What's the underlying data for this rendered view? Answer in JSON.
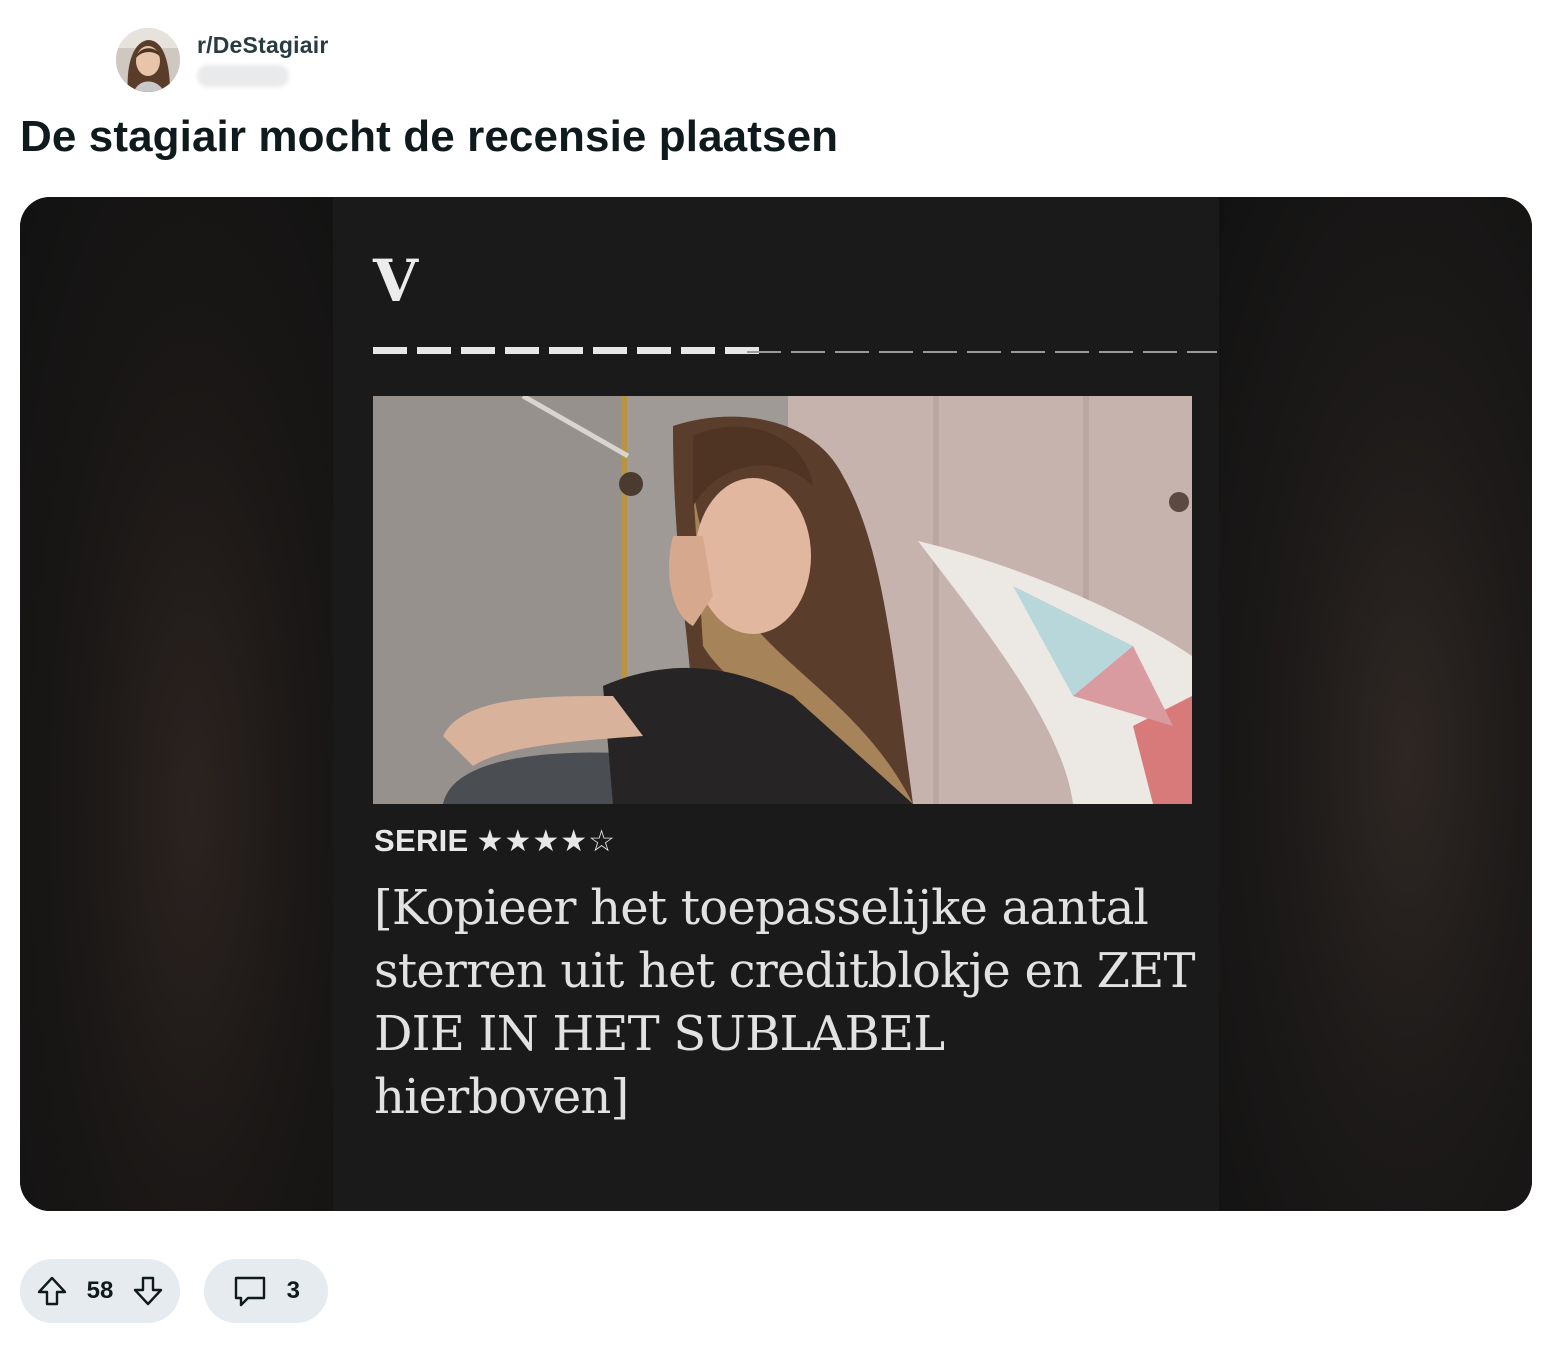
{
  "post": {
    "subreddit": "r/DeStagiair",
    "title": "De stagiair mocht de recensie plaatsen"
  },
  "image": {
    "logo_letter": "V",
    "rating_label": "SERIE",
    "stars": "★★★★☆",
    "rating_value": 4,
    "rating_max": 5,
    "headline": "[Kopieer het toepasselijke aantal sterren uit het creditblokje en ZET DIE IN HET SUBLABEL hierboven]"
  },
  "actions": {
    "upvote_icon": "arrow-up-icon",
    "downvote_icon": "arrow-down-icon",
    "comment_icon": "speech-bubble-icon",
    "score": "58",
    "comments": "3"
  }
}
